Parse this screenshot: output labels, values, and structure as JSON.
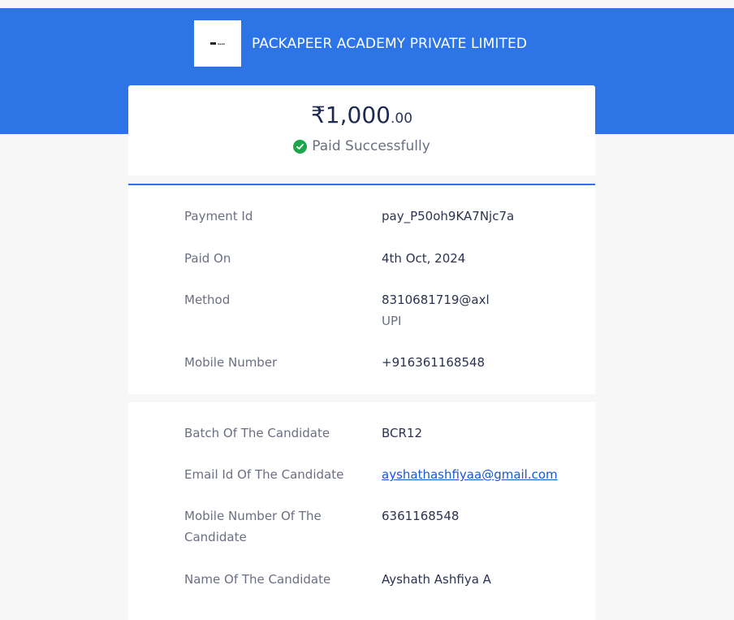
{
  "header": {
    "merchant_name": "PACKAPEER ACADEMY PRIVATE LIMITED",
    "logo_icon": "merchant-logo",
    "brand_color": "#2d74e6"
  },
  "summary": {
    "amount_main": "₹1,000",
    "amount_decimal": ".00",
    "status": "Paid Successfully",
    "status_icon": "check-circle-icon",
    "status_color": "#1ea54a"
  },
  "payment_details": [
    {
      "label": "Payment Id",
      "value": "pay_P50oh9KA7Njc7a"
    },
    {
      "label": "Paid On",
      "value": "4th Oct, 2024"
    },
    {
      "label": "Method",
      "value": "8310681719@axl",
      "sub": "UPI"
    },
    {
      "label": "Mobile Number",
      "value": "+916361168548"
    }
  ],
  "candidate_details": [
    {
      "label": "Batch Of The Candidate",
      "value": "BCR12"
    },
    {
      "label": "Email Id Of The Candidate",
      "value": "ayshathashfiyaa@gmail.com"
    },
    {
      "label": "Mobile Number Of The Candidate",
      "value": "6361168548"
    },
    {
      "label": "Name Of The Candidate",
      "value": "Ayshath Ashfiya A"
    }
  ]
}
